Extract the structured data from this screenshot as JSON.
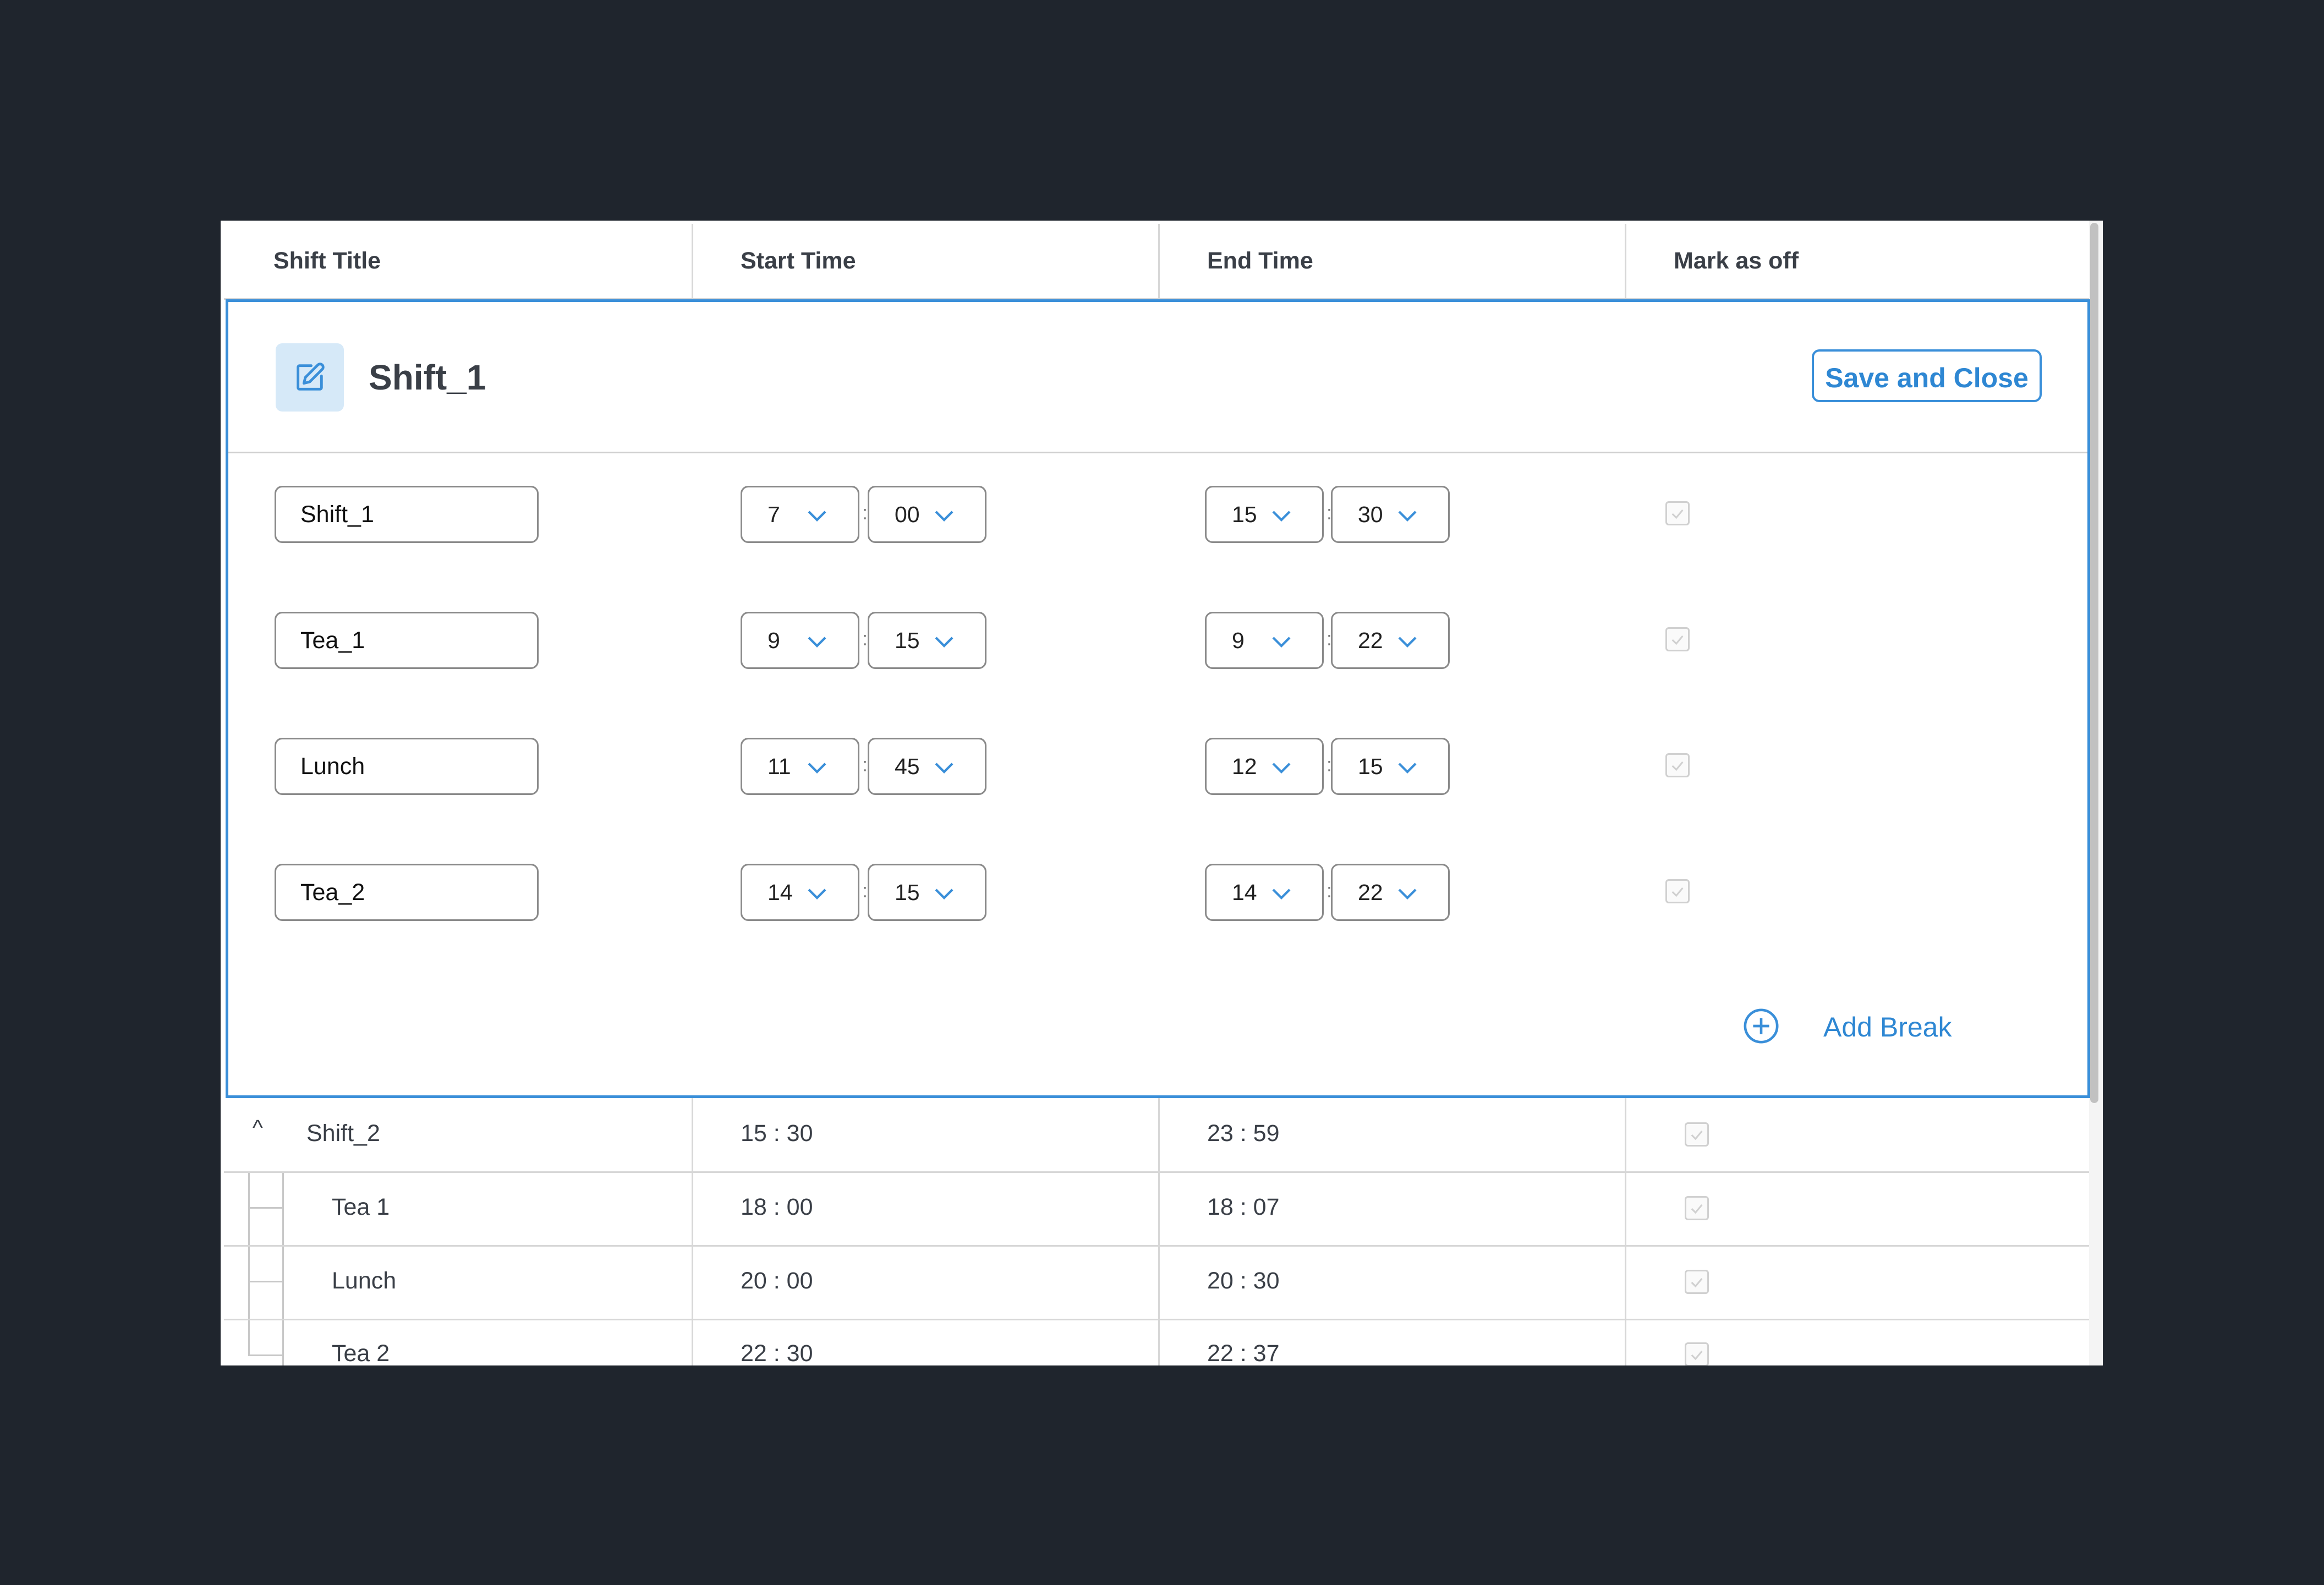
{
  "columns": [
    "Shift Title",
    "Start Time",
    "End Time",
    "Mark as off"
  ],
  "editor": {
    "title": "Shift_1",
    "save_label": "Save and Close",
    "add_break_label": "Add Break",
    "rows": [
      {
        "name": "Shift_1",
        "start_h": "7",
        "start_m": "00",
        "end_h": "15",
        "end_m": "30",
        "off": true
      },
      {
        "name": "Tea_1",
        "start_h": "9",
        "start_m": "15",
        "end_h": "9",
        "end_m": "22",
        "off": true
      },
      {
        "name": "Lunch",
        "start_h": "11",
        "start_m": "45",
        "end_h": "12",
        "end_m": "15",
        "off": true
      },
      {
        "name": "Tea_2",
        "start_h": "14",
        "start_m": "15",
        "end_h": "14",
        "end_m": "22",
        "off": true
      }
    ]
  },
  "shift2": {
    "title": "Shift_2",
    "start": "15 : 30",
    "end": "23 : 59",
    "off": true,
    "breaks": [
      {
        "name": "Tea 1",
        "start": "18 : 00",
        "end": "18 : 07",
        "off": true
      },
      {
        "name": "Lunch",
        "start": "20 : 00",
        "end": "20 : 30",
        "off": true
      },
      {
        "name": "Tea 2",
        "start": "22 : 30",
        "end": "22 : 37",
        "off": true
      }
    ]
  },
  "colors": {
    "accent": "#3a8fd9",
    "background": "#1f252d"
  }
}
